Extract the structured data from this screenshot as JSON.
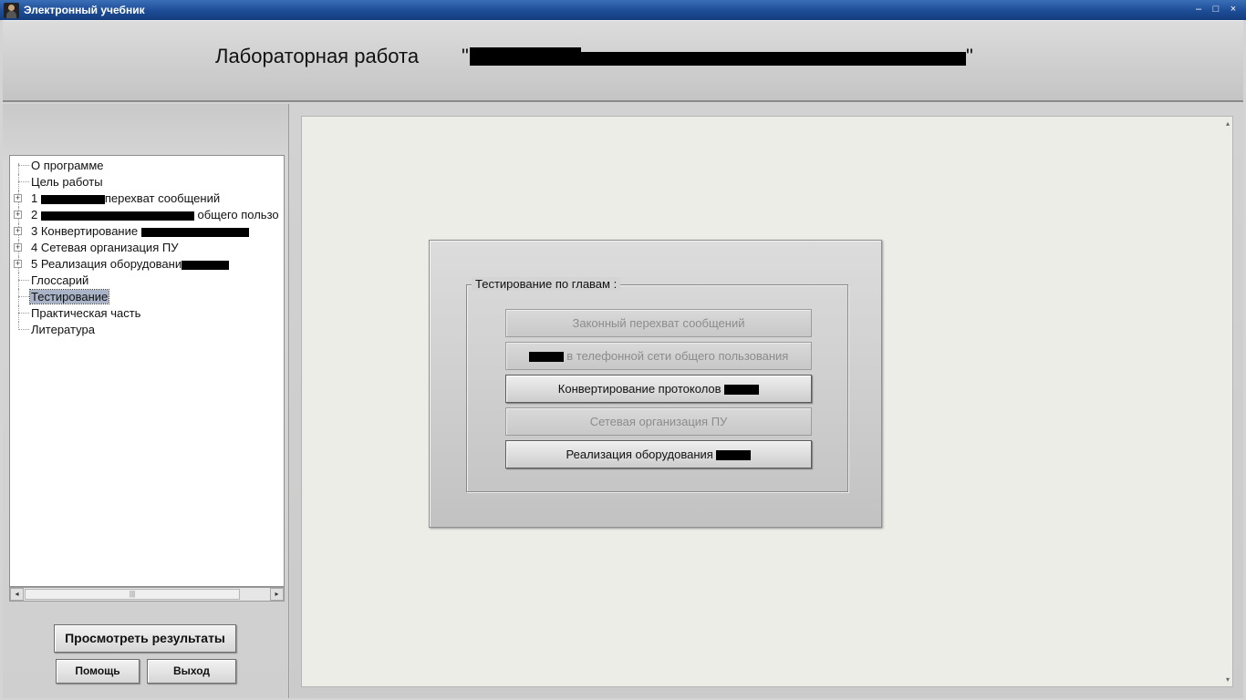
{
  "window": {
    "title": "Электронный учебник",
    "minimize_glyph": "–",
    "maximize_glyph": "□",
    "close_glyph": "×"
  },
  "header": {
    "title": "Лабораторная работа",
    "quote_open": "\"",
    "quote_close": "\""
  },
  "tree": {
    "items": [
      {
        "label": "О программе",
        "expandable": false
      },
      {
        "label": "Цель работы",
        "expandable": false
      },
      {
        "label": "1",
        "suffix": "перехват сообщений",
        "expandable": true
      },
      {
        "label": "2",
        "suffix": "общего пользо",
        "expandable": true
      },
      {
        "label": "3 Конвертирование",
        "suffix": "",
        "expandable": true
      },
      {
        "label": "4 Сетевая организация ПУ",
        "expandable": true
      },
      {
        "label": "5 Реализация оборудовани",
        "expandable": true
      },
      {
        "label": "Глоссарий",
        "expandable": false
      },
      {
        "label": "Тестирование",
        "expandable": false,
        "selected": true
      },
      {
        "label": "Практическая часть",
        "expandable": false
      },
      {
        "label": "Литература",
        "expandable": false
      }
    ]
  },
  "scrollbar": {
    "left_arrow": "◂",
    "right_arrow": "▸",
    "thumb_grip": "|||"
  },
  "buttons": {
    "view_results": "Просмотреть результаты",
    "help": "Помощь",
    "exit": "Выход"
  },
  "content": {
    "scroll_up": "▴",
    "scroll_down": "▾"
  },
  "dialog": {
    "group_title": "Тестирование по главам :",
    "chapters": [
      {
        "label": "Законный перехват сообщений",
        "enabled": false
      },
      {
        "label": "в телефонной сети общего пользования",
        "enabled": false
      },
      {
        "label": "Конвертирование протоколов",
        "enabled": true
      },
      {
        "label": "Сетевая организация ПУ",
        "enabled": false
      },
      {
        "label": "Реализация оборудования",
        "enabled": true
      }
    ]
  },
  "colors": {
    "titlebar": "#1f4f98",
    "content_bg": "#ecede6",
    "selection": "#a9b4c8"
  }
}
